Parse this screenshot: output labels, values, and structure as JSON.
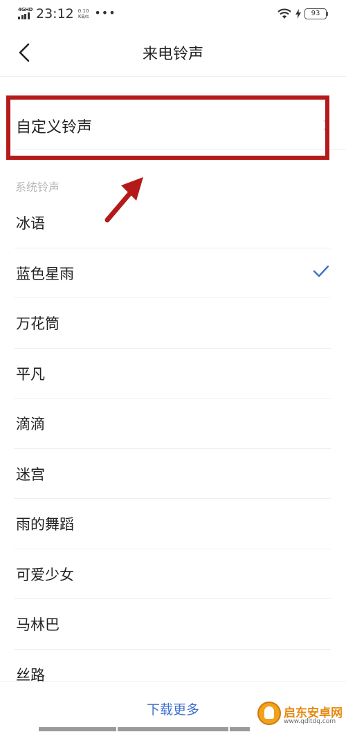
{
  "status_bar": {
    "network": "4GHD",
    "time": "23:12",
    "speed_value": "0.10",
    "speed_unit": "KB/s",
    "more": "•••",
    "battery": "93"
  },
  "header": {
    "title": "来电铃声",
    "back_icon": "chevron-left-icon"
  },
  "custom_ringtone": {
    "label": "自定义铃声",
    "chevron_icon": "chevron-right-icon"
  },
  "annotation": {
    "highlight_color": "#b51a1a",
    "arrow_icon": "red-arrow-icon"
  },
  "system_section": {
    "label": "系统铃声"
  },
  "ringtones": [
    {
      "label": "冰语",
      "selected": false
    },
    {
      "label": "蓝色星雨",
      "selected": true
    },
    {
      "label": "万花筒",
      "selected": false
    },
    {
      "label": "平凡",
      "selected": false
    },
    {
      "label": "滴滴",
      "selected": false
    },
    {
      "label": "迷宫",
      "selected": false
    },
    {
      "label": "雨的舞蹈",
      "selected": false
    },
    {
      "label": "可爱少女",
      "selected": false
    },
    {
      "label": "马林巴",
      "selected": false
    },
    {
      "label": "丝路",
      "selected": false
    }
  ],
  "bottom": {
    "download_more": "下载更多"
  },
  "watermark": {
    "name": "启东安卓网",
    "url": "www.qdltdq.com"
  },
  "colors": {
    "accent": "#3e6fd0",
    "check": "#3e6fd0",
    "text": "#222222",
    "muted": "#b7b7b7"
  }
}
